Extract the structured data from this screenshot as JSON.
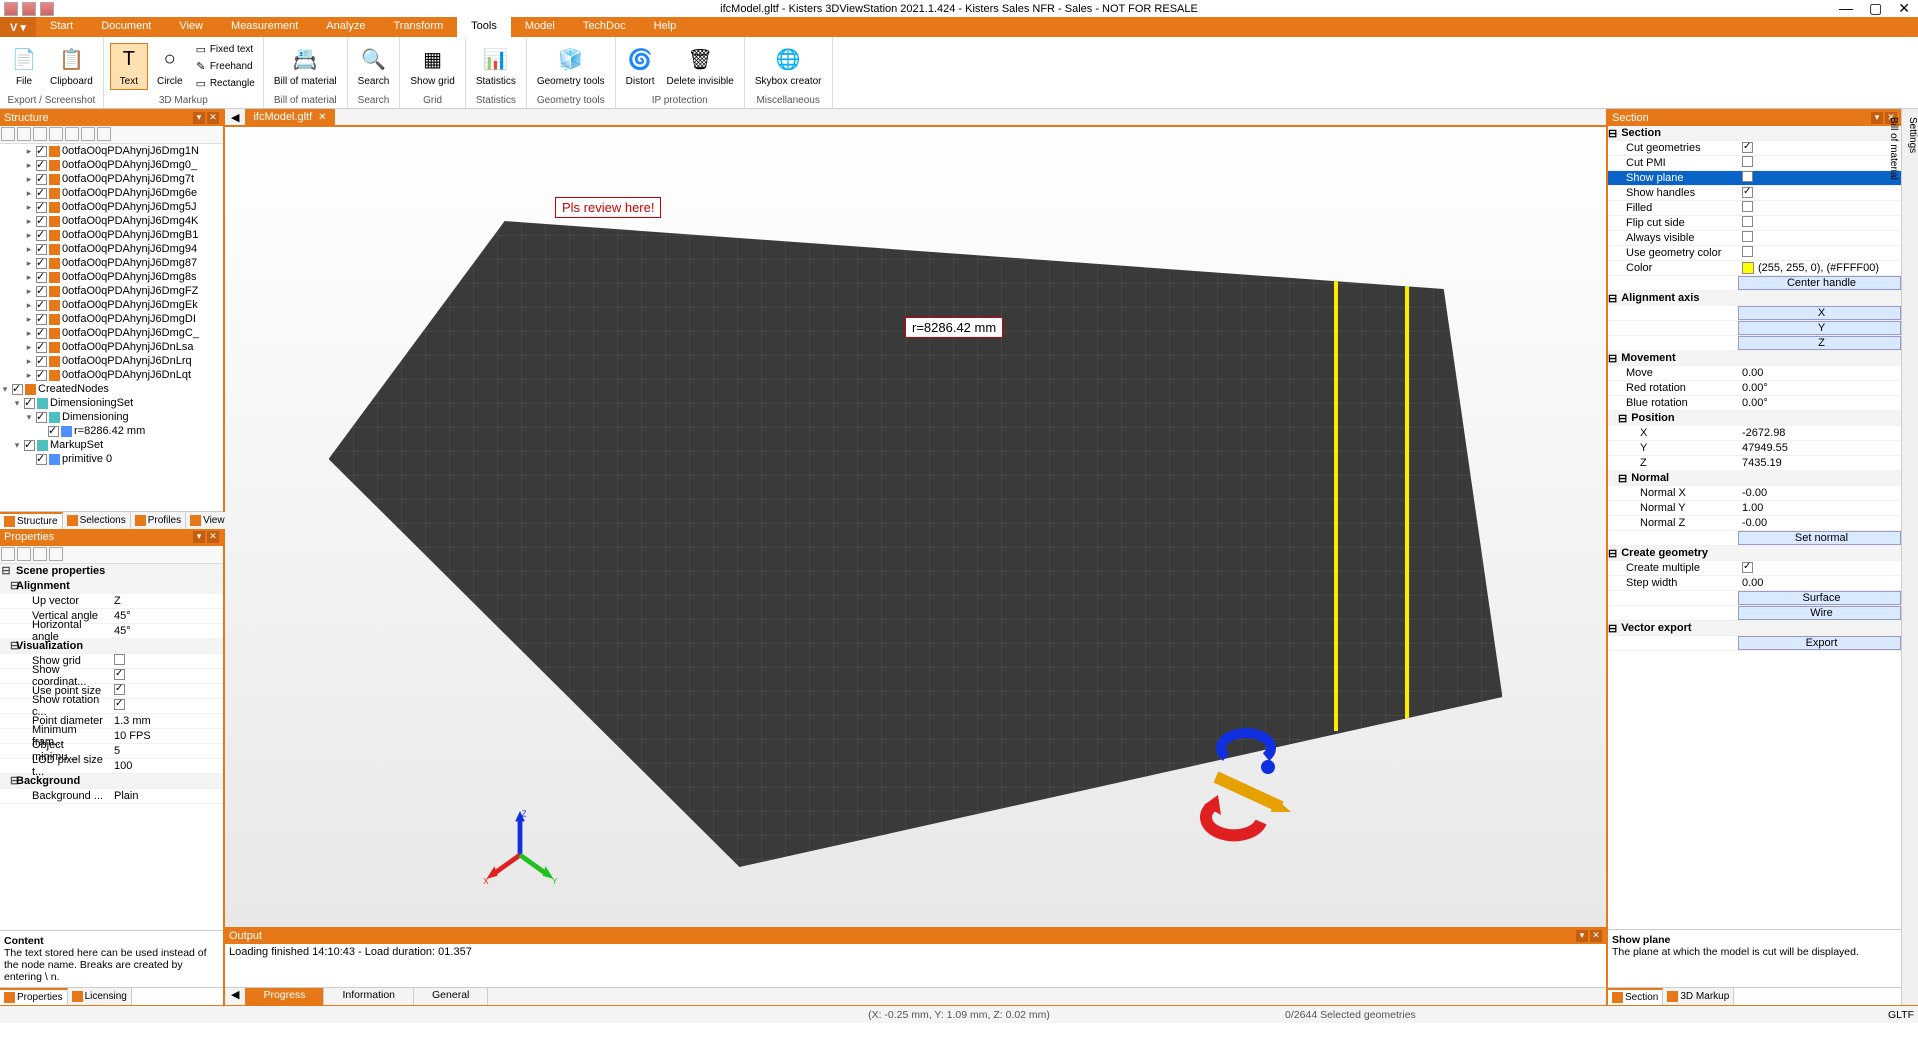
{
  "titlebar": {
    "title": "ifcModel.gltf - Kisters 3DViewStation 2021.1.424 - Kisters Sales NFR - Sales - NOT FOR RESALE"
  },
  "ribbon": {
    "tabs": [
      "Start",
      "Document",
      "View",
      "Measurement",
      "Analyze",
      "Transform",
      "Tools",
      "Model",
      "TechDoc",
      "Help"
    ],
    "active_tab": "Tools",
    "groups": {
      "export": {
        "label": "Export / Screenshot",
        "file": "File",
        "clipboard": "Clipboard"
      },
      "markup": {
        "label": "3D Markup",
        "text": "Text",
        "circle": "Circle",
        "fixed": "Fixed text",
        "freehand": "Freehand",
        "rect": "Rectangle"
      },
      "bom": {
        "label": "Bill of material",
        "bom": "Bill of material"
      },
      "search": {
        "label": "Search",
        "search": "Search"
      },
      "grid": {
        "label": "Grid",
        "showgrid": "Show grid"
      },
      "stats": {
        "label": "Statistics",
        "stats": "Statistics"
      },
      "geo": {
        "label": "Geometry tools",
        "gtools": "Geometry tools"
      },
      "ip": {
        "label": "IP protection",
        "distort": "Distort",
        "delinv": "Delete invisible"
      },
      "misc": {
        "label": "Miscellaneous",
        "skybox": "Skybox creator"
      }
    }
  },
  "structure": {
    "title": "Structure",
    "nodes": [
      "0otfaO0qPDAhynjJ6Dmg1N",
      "0otfaO0qPDAhynjJ6Dmg0_",
      "0otfaO0qPDAhynjJ6Dmg7t",
      "0otfaO0qPDAhynjJ6Dmg6e",
      "0otfaO0qPDAhynjJ6Dmg5J",
      "0otfaO0qPDAhynjJ6Dmg4K",
      "0otfaO0qPDAhynjJ6DmgB1",
      "0otfaO0qPDAhynjJ6Dmg94",
      "0otfaO0qPDAhynjJ6Dmg87",
      "0otfaO0qPDAhynjJ6Dmg8s",
      "0otfaO0qPDAhynjJ6DmgFZ",
      "0otfaO0qPDAhynjJ6DmgEk",
      "0otfaO0qPDAhynjJ6DmgDI",
      "0otfaO0qPDAhynjJ6DmgC_",
      "0otfaO0qPDAhynjJ6DnLsa",
      "0otfaO0qPDAhynjJ6DnLrq",
      "0otfaO0qPDAhynjJ6DnLqt"
    ],
    "created": "CreatedNodes",
    "dimset": "DimensioningSet",
    "dimens": "Dimensioning",
    "radius": "r=8286.42 mm",
    "markupset": "MarkupSet",
    "primitive": "primitive 0",
    "tabs": [
      "Structure",
      "Selections",
      "Profiles",
      "Views"
    ]
  },
  "properties": {
    "title": "Properties",
    "scene": "Scene properties",
    "alignment": "Alignment",
    "upvec": "Up vector",
    "upvec_v": "Z",
    "vang": "Vertical angle",
    "vang_v": "45°",
    "hang": "Horizontal angle",
    "hang_v": "45°",
    "vis": "Visualization",
    "showgrid": "Show grid",
    "showcoord": "Show coordinat...",
    "usepoint": "Use point size",
    "showrot": "Show rotation c...",
    "pointd": "Point diameter",
    "pointd_v": "1.3 mm",
    "minfram": "Minimum fram...",
    "minfram_v": "10 FPS",
    "objmin": "Object minimu...",
    "objmin_v": "5",
    "lodpx": "LOD pixel size t...",
    "lodpx_v": "100",
    "background": "Background",
    "bgmode": "Background ...",
    "bgmode_v": "Plain",
    "content_hd": "Content",
    "content_tx": "The text stored here can be used instead of the node name. Breaks are created by entering \\ n.",
    "bottom_tabs": [
      "Properties",
      "Licensing"
    ]
  },
  "viewport": {
    "doc_tab": "ifcModel.gltf",
    "annot_review": "Pls review here!",
    "annot_radius": "r=8286.42 mm",
    "axis": {
      "x": "X",
      "y": "Y",
      "z": "Z"
    }
  },
  "output": {
    "title": "Output",
    "line": "Loading finished 14:10:43 - Load duration: 01.357",
    "tabs": [
      "Progress",
      "Information",
      "General"
    ]
  },
  "section": {
    "title": "Section",
    "sec": "Section",
    "cutgeo": "Cut geometries",
    "cutpmi": "Cut PMI",
    "showplane": "Show plane",
    "showhandles": "Show handles",
    "filled": "Filled",
    "flipcut": "Flip cut side",
    "always": "Always visible",
    "usegeocol": "Use geometry color",
    "color": "Color",
    "color_v": "(255, 255, 0), (#FFFF00)",
    "centerhandle": "Center handle",
    "alignaxis": "Alignment axis",
    "ax_x": "X",
    "ax_y": "Y",
    "ax_z": "Z",
    "movement": "Movement",
    "move": "Move",
    "move_v": "0.00",
    "redrot": "Red rotation",
    "redrot_v": "0.00°",
    "bluerot": "Blue rotation",
    "bluerot_v": "0.00°",
    "position": "Position",
    "px": "X",
    "px_v": "-2672.98",
    "py": "Y",
    "py_v": "47949.55",
    "pz": "Z",
    "pz_v": "7435.19",
    "normal": "Normal",
    "nx": "Normal X",
    "nx_v": "-0.00",
    "ny": "Normal Y",
    "ny_v": "1.00",
    "nz": "Normal Z",
    "nz_v": "-0.00",
    "setnormal": "Set normal",
    "creategeo": "Create geometry",
    "createmult": "Create multiple",
    "stepwidth": "Step width",
    "stepwidth_v": "0.00",
    "surface": "Surface",
    "wire": "Wire",
    "vexport": "Vector export",
    "export": "Export",
    "desc_hd": "Show plane",
    "desc_tx": "The plane at which the model is cut will be displayed.",
    "bottom_tabs": [
      "Section",
      "3D Markup"
    ]
  },
  "right_rail": {
    "settings": "Settings",
    "bom": "Bill of material"
  },
  "statusbar": {
    "coords": "(X: -0.25 mm, Y: 1.09 mm, Z: 0.02 mm)",
    "sel": "0/2644 Selected geometries",
    "fmt": "GLTF"
  }
}
